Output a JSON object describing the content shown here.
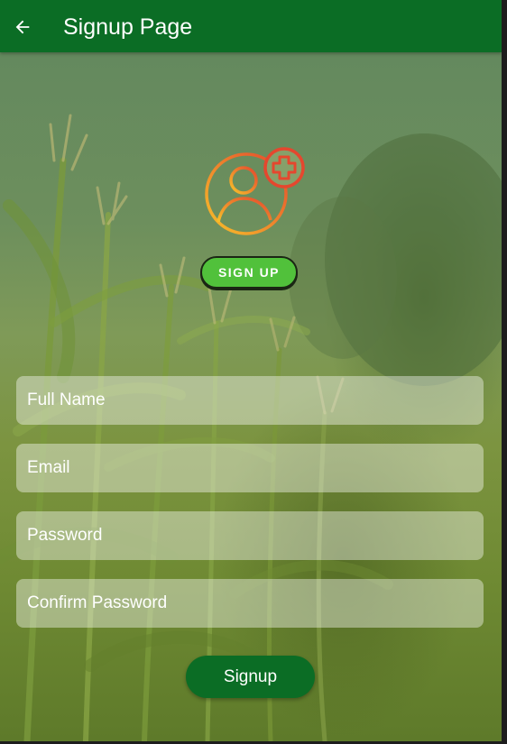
{
  "appbar": {
    "title": "Signup Page",
    "back_icon": "arrow-left-icon",
    "color": "#0b6d25"
  },
  "logo": {
    "icon": "user-plus-icon",
    "badge_text": "SIGN UP"
  },
  "form": {
    "full_name_placeholder": "Full Name",
    "email_placeholder": "Email",
    "password_placeholder": "Password",
    "confirm_password_placeholder": "Confirm Password",
    "submit_label": "Signup"
  },
  "colors": {
    "primary": "#0b6d25",
    "badge_green": "#51c13b",
    "logo_orange": "#f4a12a",
    "logo_red": "#e5472e"
  }
}
